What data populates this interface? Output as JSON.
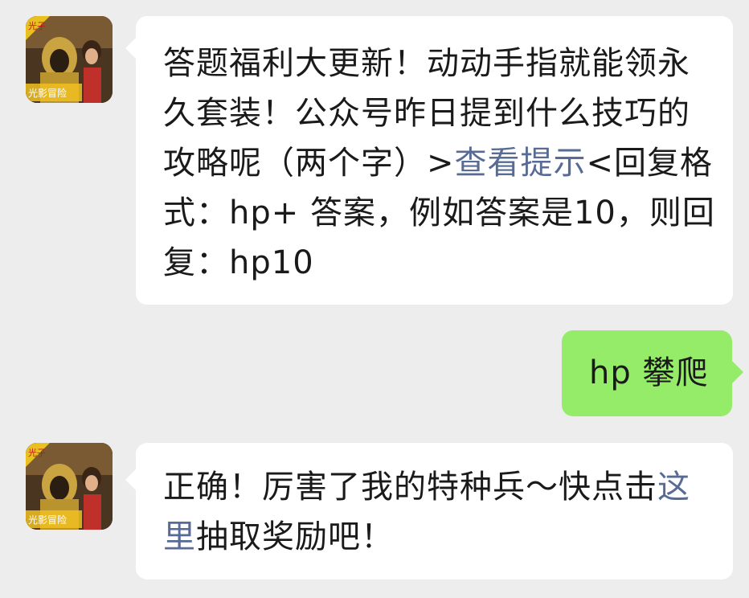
{
  "chat": {
    "messages": [
      {
        "sender": "official-account",
        "avatar_badge_top": "光子",
        "avatar_badge_bottom": "光影冒险",
        "text_before_link": "答题福利大更新！动动手指就能领永久套装！公众号昨日提到什么技巧的攻略呢（两个字）>",
        "link_text": "查看提示",
        "text_after_link": "<回复格式：hp+ 答案，例如答案是10，则回复：hp10"
      },
      {
        "sender": "me",
        "text": "hp 攀爬"
      },
      {
        "sender": "official-account",
        "avatar_badge_top": "光子",
        "avatar_badge_bottom": "光影冒险",
        "text_before_link": "正确！厉害了我的特种兵～快点击",
        "link_text": "这里",
        "text_after_link": "抽取奖励吧！"
      }
    ]
  },
  "colors": {
    "background": "#ededed",
    "incoming_bubble": "#ffffff",
    "outgoing_bubble": "#95ec69",
    "link": "#576b95",
    "text": "#1a1a1a"
  }
}
